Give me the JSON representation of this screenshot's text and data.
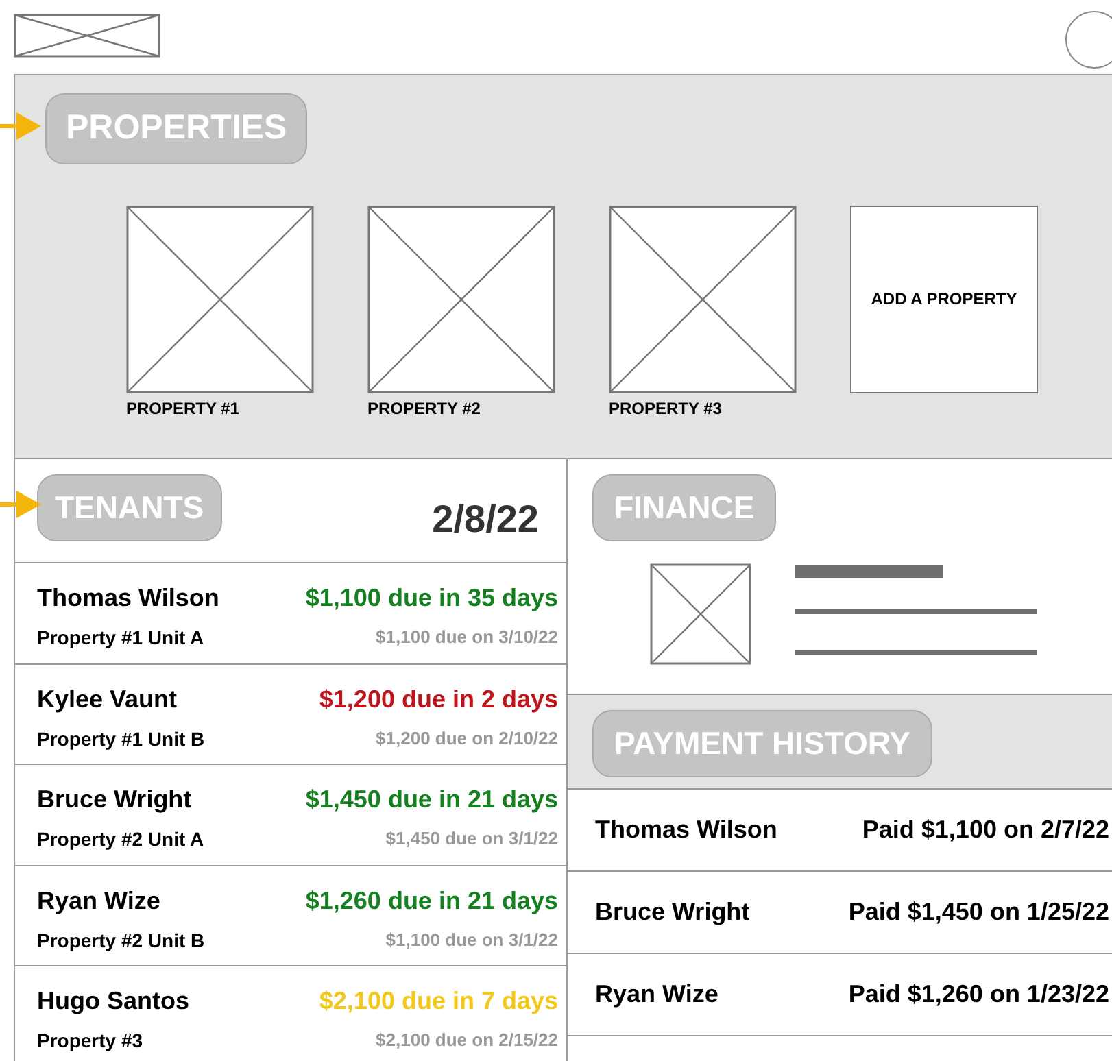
{
  "properties": {
    "title": "PROPERTIES",
    "items": [
      {
        "kind": "property",
        "label": "PROPERTY #1"
      },
      {
        "kind": "property",
        "label": "PROPERTY #2"
      },
      {
        "kind": "property",
        "label": "PROPERTY #3"
      },
      {
        "kind": "add",
        "label": "ADD A PROPERTY"
      }
    ]
  },
  "tenants": {
    "title": "TENANTS",
    "date": "2/8/22",
    "rows": [
      {
        "name": "Thomas Wilson",
        "unit": "Property #1 Unit A",
        "due": "$1,100 due in 35 days",
        "color": "#15801f",
        "due_date": "$1,100 due on 3/10/22"
      },
      {
        "name": "Kylee Vaunt",
        "unit": "Property #1 Unit B",
        "due": "$1,200 due in 2 days",
        "color": "#c0141c",
        "due_date": "$1,200 due on 2/10/22"
      },
      {
        "name": "Bruce Wright",
        "unit": "Property #2 Unit A",
        "due": "$1,450 due in 21 days",
        "color": "#15801f",
        "due_date": "$1,450 due on 3/1/22"
      },
      {
        "name": "Ryan Wize",
        "unit": "Property #2 Unit B",
        "due": "$1,260 due in 21 days",
        "color": "#15801f",
        "due_date": "$1,100 due on 3/1/22"
      },
      {
        "name": "Hugo Santos",
        "unit": "Property #3",
        "due": "$2,100 due in 7 days",
        "color": "#f2c81a",
        "due_date": "$2,100 due on 2/15/22"
      }
    ]
  },
  "finance": {
    "title": "FINANCE"
  },
  "payment_history": {
    "title": "PAYMENT HISTORY",
    "rows": [
      {
        "name": "Thomas Wilson",
        "payment": "Paid $1,100 on 2/7/22"
      },
      {
        "name": "Bruce Wright",
        "payment": "Paid $1,450 on 1/25/22"
      },
      {
        "name": "Ryan Wize",
        "payment": "Paid $1,260 on 1/23/22"
      }
    ]
  }
}
